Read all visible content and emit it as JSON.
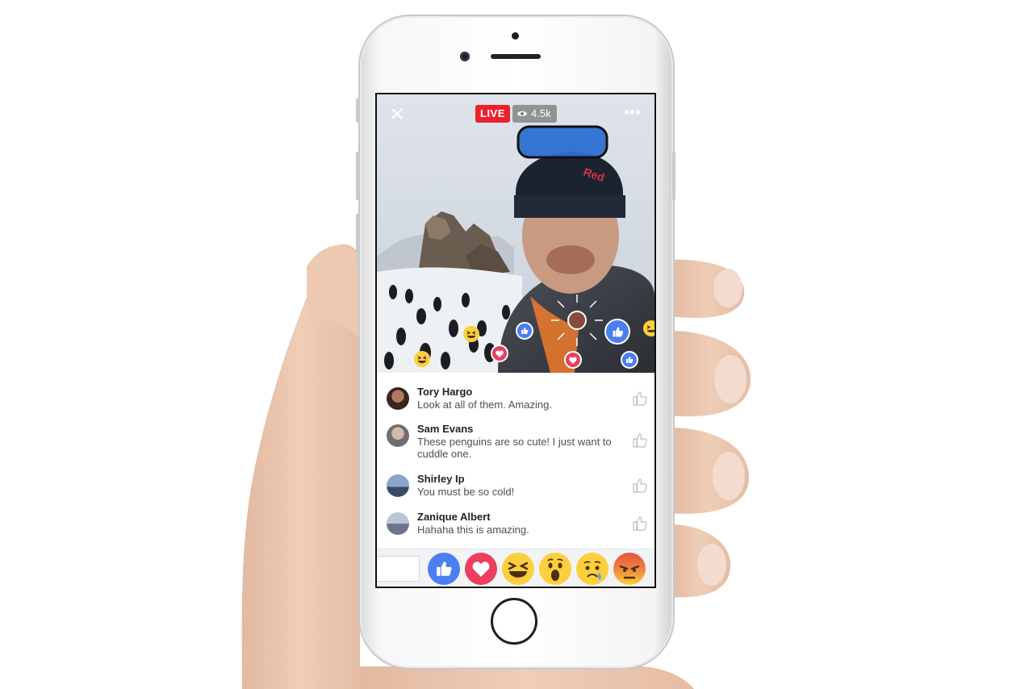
{
  "stream": {
    "live_label": "LIVE",
    "viewer_count": "4.5k",
    "close_icon": "close-icon",
    "more_icon": "more-dots-icon"
  },
  "comments": [
    {
      "name": "Tory Hargo",
      "text": "Look at all of them. Amazing."
    },
    {
      "name": "Sam Evans",
      "text": "These penguins are so cute! I just want to cuddle one."
    },
    {
      "name": "Shirley Ip",
      "text": "You must be so cold!"
    },
    {
      "name": "Zanique Albert",
      "text": "Hahaha this is amazing."
    }
  ],
  "reactions": [
    "like",
    "love",
    "haha",
    "wow",
    "sad",
    "angry"
  ],
  "colors": {
    "live_red": "#e9222c",
    "like_blue": "#4a7ef2",
    "love_red": "#ec3e5d",
    "emoji_yellow": "#fccf3d",
    "angry_red": "#e8523a"
  }
}
